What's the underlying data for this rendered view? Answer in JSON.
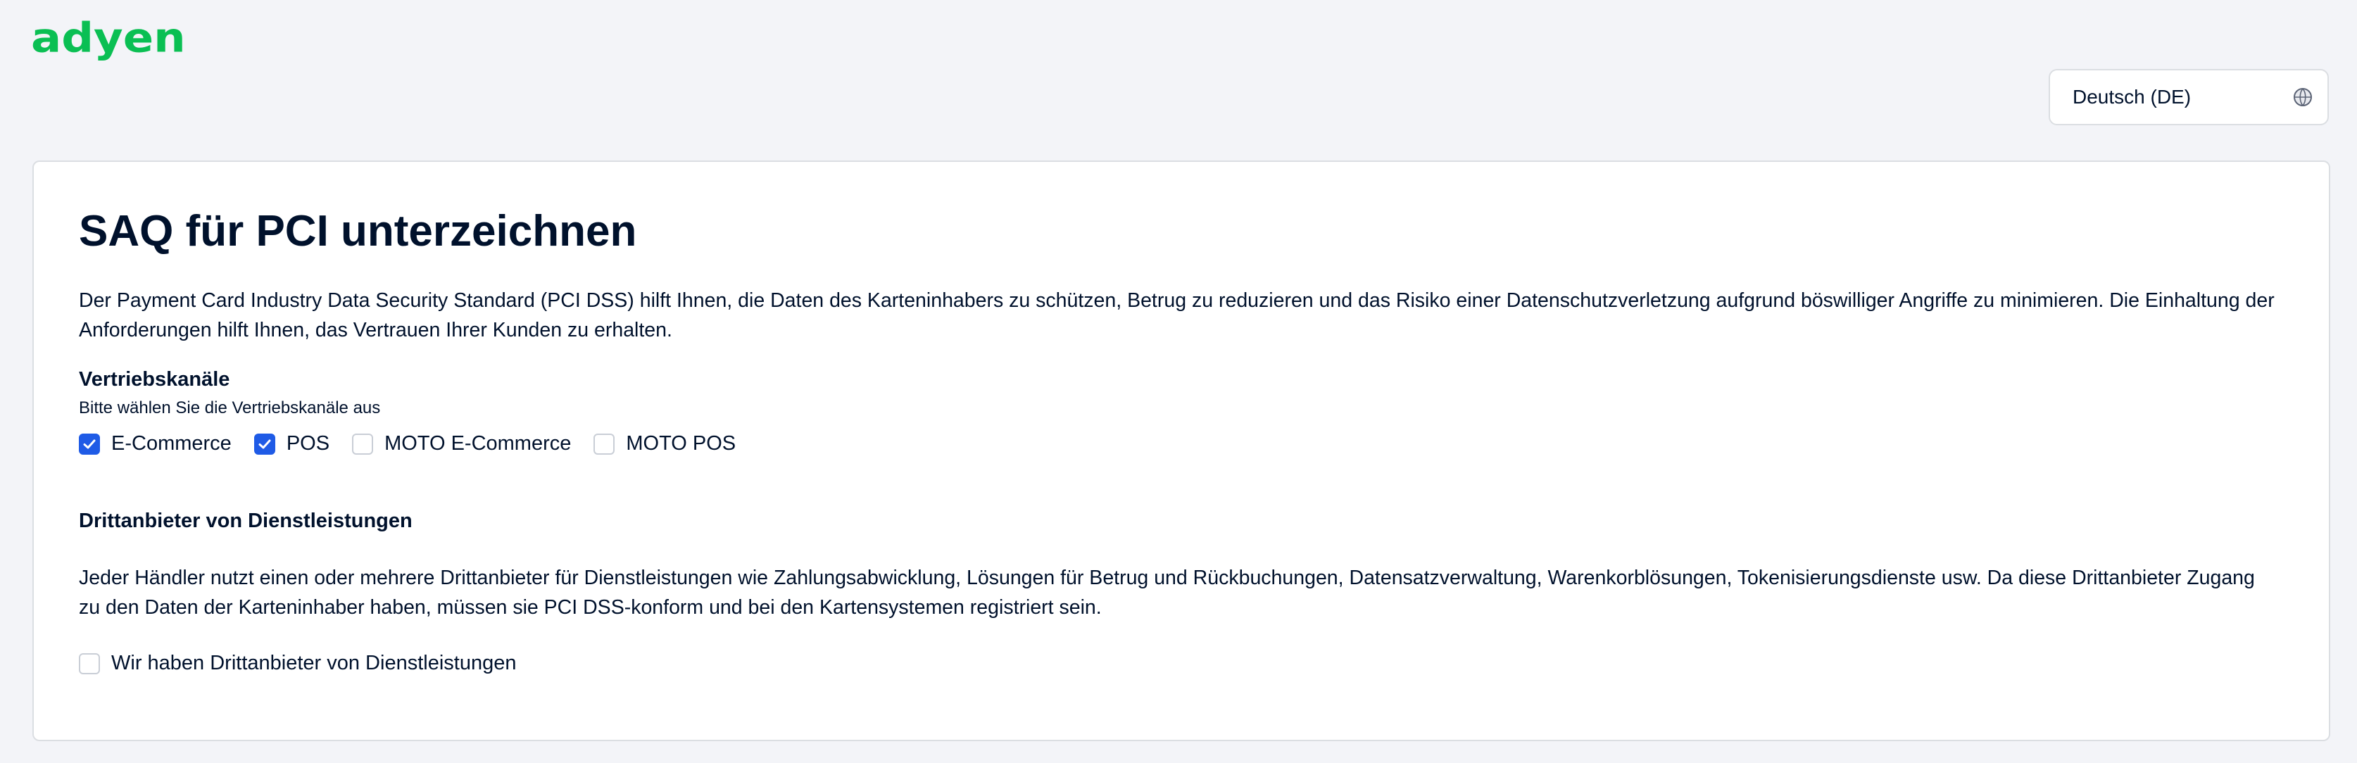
{
  "brand": {
    "logo_text": "adyen",
    "color": "#0abf53"
  },
  "language_selector": {
    "value": "Deutsch (DE)",
    "icon": "globe-icon"
  },
  "page": {
    "title": "SAQ für PCI unterzeichnen",
    "intro": "Der Payment Card Industry Data Security Standard (PCI DSS) hilft Ihnen, die Daten des Karteninhabers zu schützen, Betrug zu reduzieren und das Risiko einer Datenschutzverletzung aufgrund böswilliger Angriffe zu minimieren. Die Einhaltung der Anforderungen hilft Ihnen, das Vertrauen Ihrer Kunden zu erhalten."
  },
  "sales_channels": {
    "heading": "Vertriebskanäle",
    "helper": "Bitte wählen Sie die Vertriebskanäle aus",
    "options": [
      {
        "label": "E-Commerce",
        "checked": true
      },
      {
        "label": "POS",
        "checked": true
      },
      {
        "label": "MOTO E-Commerce",
        "checked": false
      },
      {
        "label": "MOTO POS",
        "checked": false
      }
    ]
  },
  "third_party": {
    "heading": "Drittanbieter von Dienstleistungen",
    "text": "Jeder Händler nutzt einen oder mehrere Drittanbieter für Dienstleistungen wie Zahlungsabwicklung, Lösungen für Betrug und Rückbuchungen, Datensatzverwaltung, Warenkorblösungen, Tokenisierungsdienste usw. Da diese Drittanbieter Zugang zu den Daten der Karteninhaber haben, müssen sie PCI DSS-konform und bei den Kartensystemen registriert sein.",
    "checkbox_label": "Wir haben Drittanbieter von Dienstleistungen",
    "checked": false
  },
  "colors": {
    "accent": "#1f5be6",
    "text": "#00112c",
    "background": "#f3f4f8",
    "border": "#dbdee2"
  }
}
